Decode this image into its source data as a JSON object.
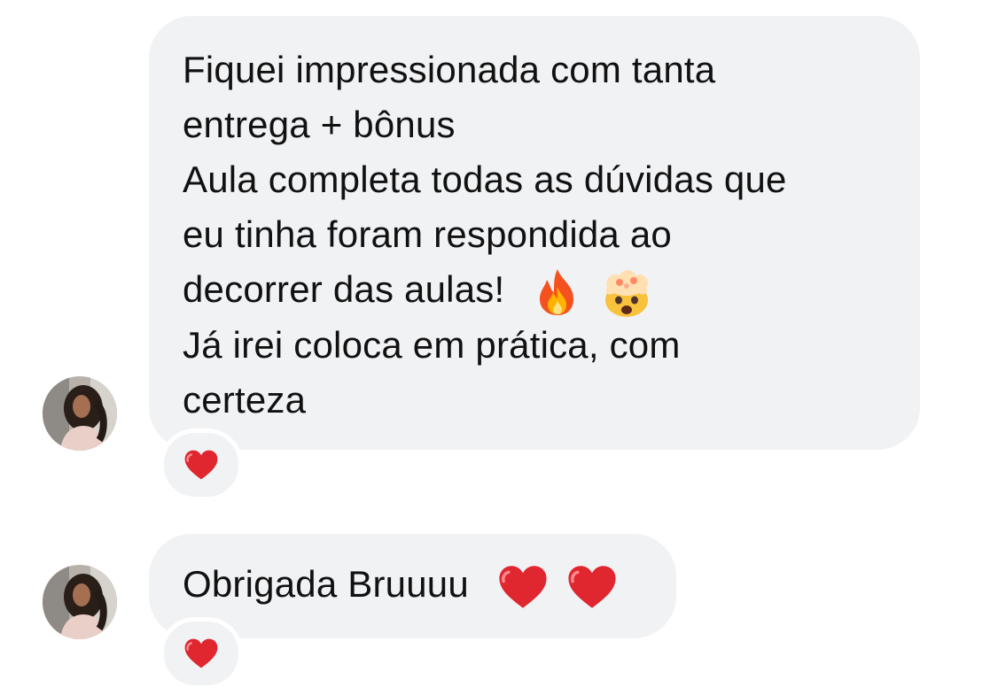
{
  "messages": [
    {
      "avatar_icon": "profile-photo-avatar",
      "lines": [
        "Fiquei impressionada com tanta",
        "entrega + bônus",
        "Aula completa todas as dúvidas que",
        "eu tinha foram respondida ao",
        "decorrer das aulas!",
        "Já irei coloca em prática, com",
        "certeza"
      ],
      "inline_emojis": [
        "fire-emoji",
        "exploding-head-emoji"
      ],
      "reaction": "red-heart-emoji"
    },
    {
      "avatar_icon": "profile-photo-avatar",
      "text": "Obrigada Bruuuu",
      "inline_emojis": [
        "red-heart-emoji",
        "red-heart-emoji"
      ],
      "reaction": "red-heart-emoji"
    }
  ],
  "colors": {
    "bubble_background": "#f1f2f4",
    "text": "#111111",
    "heart": "#e0262f"
  }
}
